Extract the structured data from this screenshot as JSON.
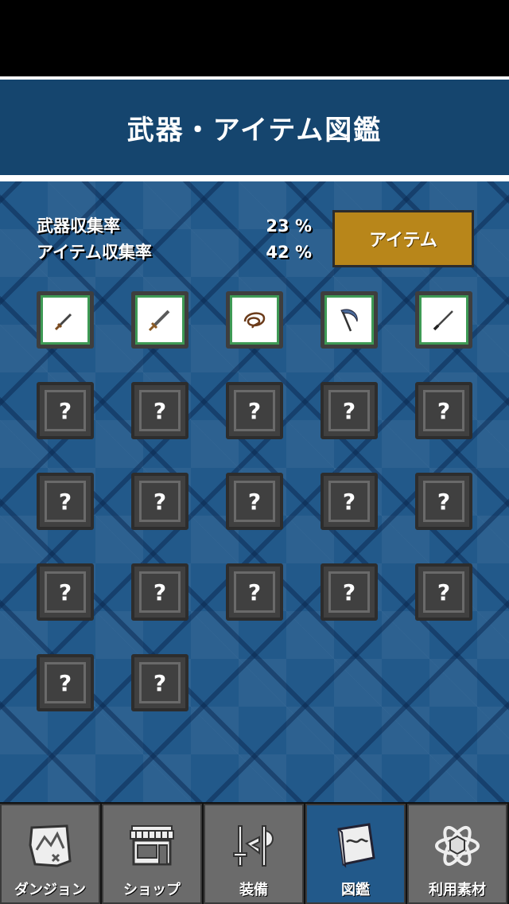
{
  "header": {
    "title": "武器・アイテム図鑑"
  },
  "stats": {
    "weapon_label": "武器収集率",
    "weapon_value": "23 %",
    "item_label": "アイテム収集率",
    "item_value": "42 %"
  },
  "toggle_button": {
    "label": "アイテム"
  },
  "grid": {
    "unknown_mark": "?",
    "known_items": [
      "dagger-icon",
      "short-sword-icon",
      "whip-icon",
      "scythe-icon",
      "knife-icon"
    ],
    "unknown_count": 17
  },
  "tabs": [
    {
      "label": "ダンジョン",
      "icon": "map-icon"
    },
    {
      "label": "ショップ",
      "icon": "shop-icon"
    },
    {
      "label": "装備",
      "icon": "equipment-icon"
    },
    {
      "label": "図鑑",
      "icon": "book-icon",
      "active": true
    },
    {
      "label": "利用素材",
      "icon": "atom-icon"
    }
  ],
  "colors": {
    "header_bg": "#15456e",
    "main_bg": "#22598a",
    "button_gold": "#b8861a",
    "known_border": "#3e9a55",
    "tab_bg": "#6b6b6b",
    "tab_active_bg": "#22598a"
  }
}
